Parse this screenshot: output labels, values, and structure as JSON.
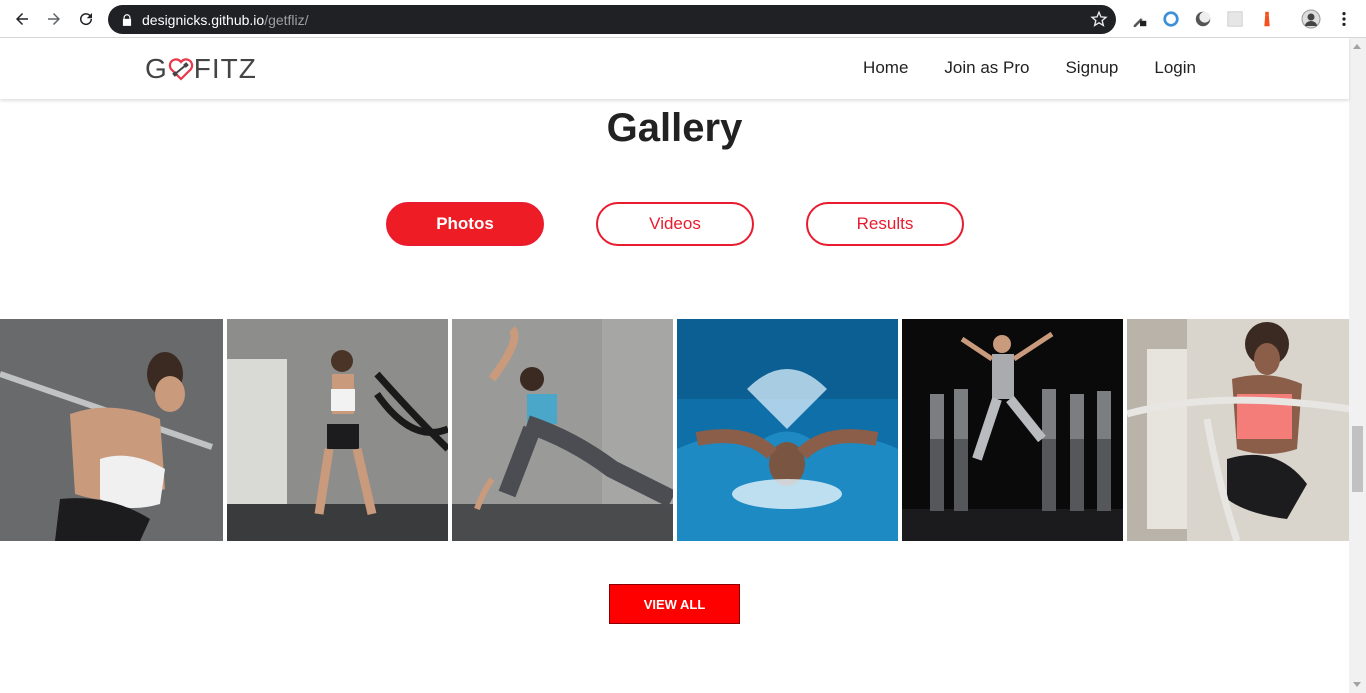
{
  "browser": {
    "url_host": "designicks.github.io",
    "url_path": "/getfliz/"
  },
  "site": {
    "logo_left": "G",
    "logo_right": "FITZ",
    "nav": [
      "Home",
      "Join as Pro",
      "Signup",
      "Login"
    ]
  },
  "gallery": {
    "title": "Gallery",
    "tabs": [
      {
        "label": "Photos",
        "active": true
      },
      {
        "label": "Videos",
        "active": false
      },
      {
        "label": "Results",
        "active": false
      }
    ],
    "photos": [
      "barbell-squat",
      "battle-ropes",
      "lunge-stretch",
      "butterfly-swimmer",
      "dance-troupe",
      "rope-workout"
    ],
    "view_all_label": "VIEW ALL"
  },
  "colors": {
    "accent": "#ee1c25",
    "omnibox": "#202124"
  }
}
